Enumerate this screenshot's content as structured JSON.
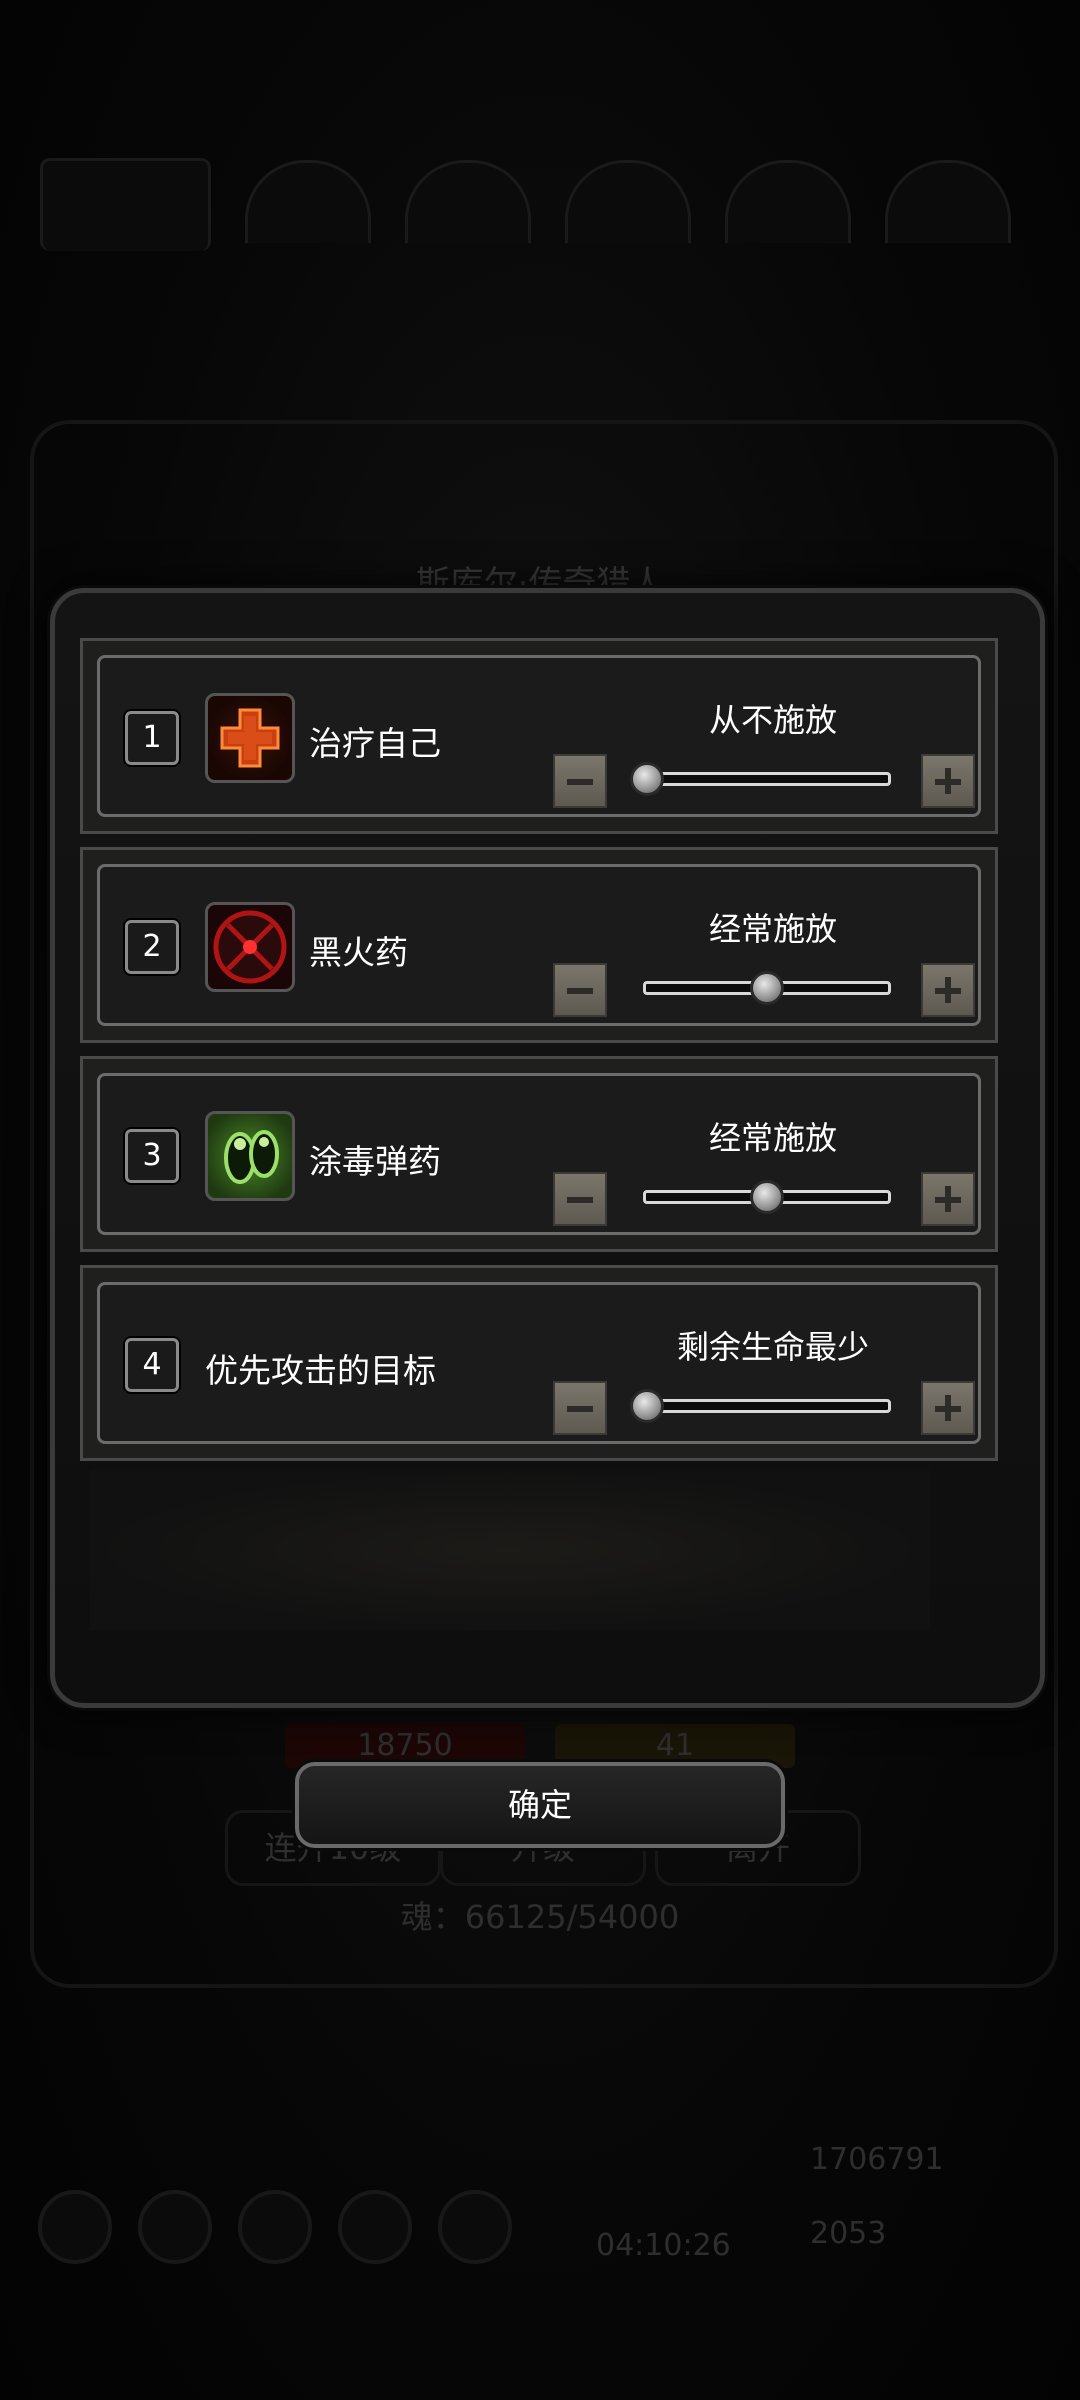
{
  "background": {
    "title": "斯库尔·传奇猎人",
    "health": "18750",
    "energy": "41",
    "buttons": [
      "连升10级",
      "升级",
      "离开"
    ],
    "soul": "魂：66125/54000",
    "timer": "04:10:26",
    "gold": "1706791",
    "gems": "2053"
  },
  "dialog": {
    "rows": [
      {
        "number": "1",
        "icon": "heal-cross-icon",
        "name": "治疗自己",
        "setting": "从不施放",
        "level": 0
      },
      {
        "number": "2",
        "icon": "black-powder-bomb-icon",
        "name": "黑火药",
        "setting": "经常施放",
        "level": 0.5
      },
      {
        "number": "3",
        "icon": "poison-ammo-icon",
        "name": "涂毒弹药",
        "setting": "经常施放",
        "level": 0.5
      },
      {
        "number": "4",
        "icon": "",
        "name": "优先攻击的目标",
        "setting": "剩余生命最少",
        "level": 0
      }
    ],
    "confirm_label": "确定"
  },
  "colors": {
    "health_bar": "#6b0d0d",
    "energy_bar": "#7a6a1a",
    "heal_icon": "#e0531c",
    "bomb_icon": "#c01818",
    "poison_icon": "#6fbf3a"
  }
}
